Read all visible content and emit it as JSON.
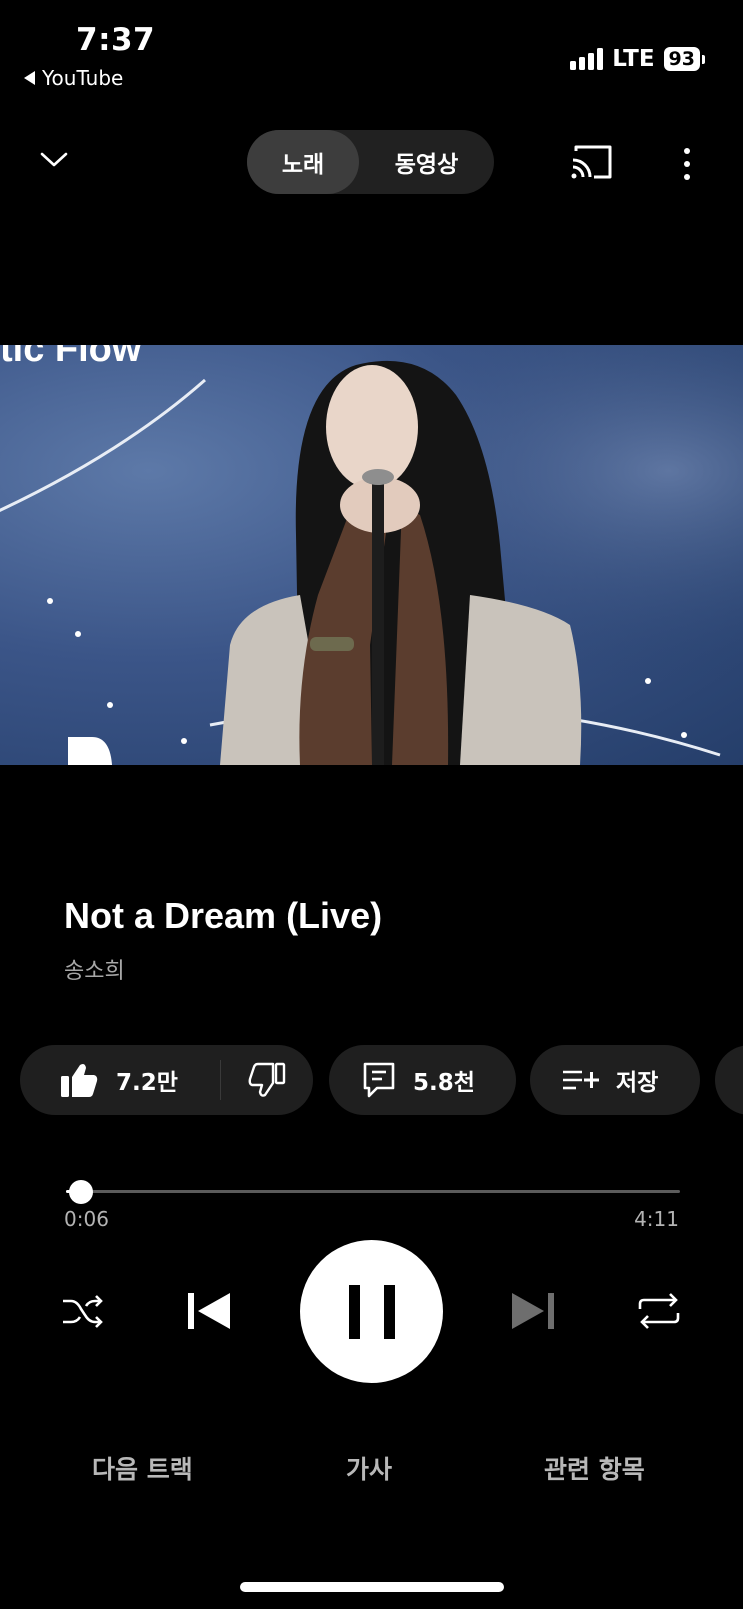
{
  "status_bar": {
    "time": "7:37",
    "back_app": "YouTube",
    "network": "LTE",
    "battery": "93"
  },
  "nav": {
    "tabs": [
      {
        "label": "노래",
        "active": true
      },
      {
        "label": "동영상",
        "active": false
      }
    ]
  },
  "artwork": {
    "overlay_text": "tic Flow"
  },
  "track": {
    "title": "Not a Dream (Live)",
    "artist": "송소희"
  },
  "actions": {
    "likes": "7.2만",
    "comments": "5.8천",
    "save_label": "저장"
  },
  "player": {
    "elapsed": "0:06",
    "total": "4:11",
    "progress_fraction": 0.024,
    "state": "playing"
  },
  "bottom_tabs": {
    "up_next": "다음 트랙",
    "lyrics": "가사",
    "related": "관련 항목"
  },
  "icons": {
    "collapse": "chevron-down-icon",
    "cast": "cast-icon",
    "more": "more-vert-icon",
    "like": "thumbs-up-icon",
    "dislike": "thumbs-down-icon",
    "comments": "comment-icon",
    "save": "playlist-add-icon",
    "shuffle": "shuffle-icon",
    "previous": "skip-previous-icon",
    "pause": "pause-icon",
    "next": "skip-next-icon",
    "repeat": "repeat-icon"
  },
  "colors": {
    "background": "#000000",
    "chip": "#1f1f1f",
    "secondary_text": "#a8a8a8"
  }
}
